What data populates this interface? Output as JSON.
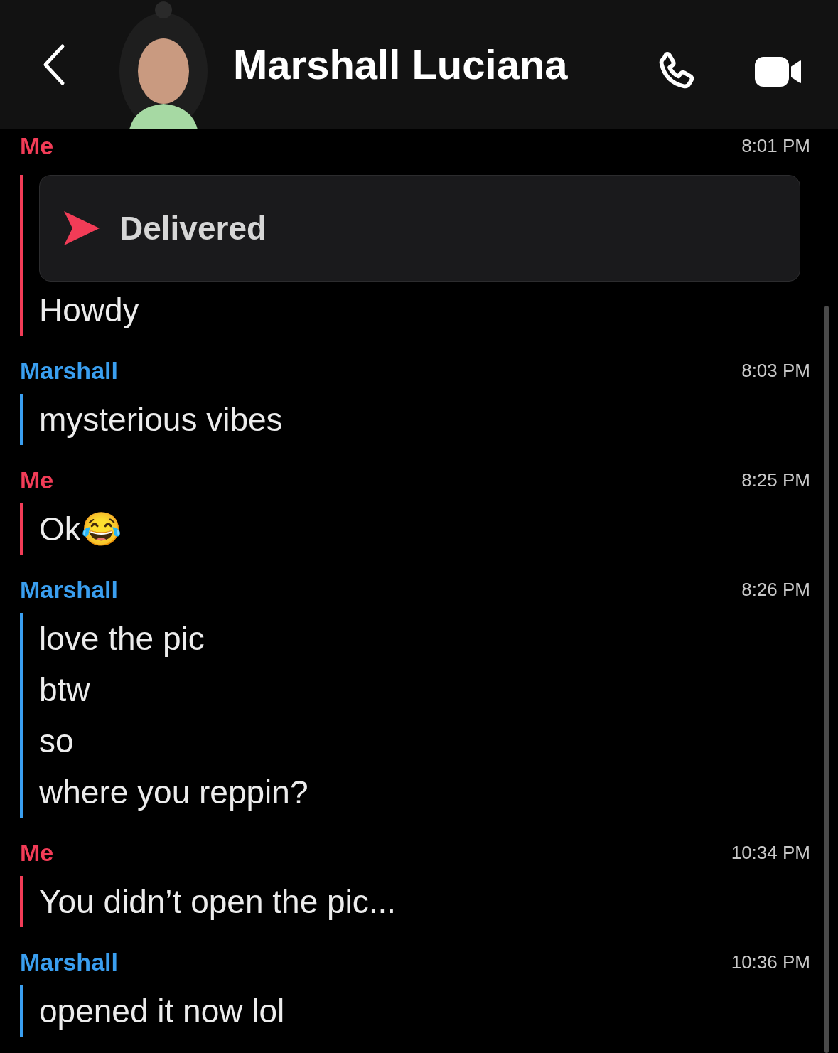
{
  "header": {
    "title": "Marshall Luciana"
  },
  "messages": [
    {
      "sender": "Me",
      "color": "#f23c57",
      "time": "8:01 PM",
      "items": [
        {
          "kind": "status",
          "text": "Delivered"
        },
        {
          "kind": "text",
          "text": "Howdy"
        }
      ]
    },
    {
      "sender": "Marshall",
      "color": "#3a9ff0",
      "time": "8:03 PM",
      "items": [
        {
          "kind": "text",
          "text": "mysterious vibes"
        }
      ]
    },
    {
      "sender": "Me",
      "color": "#f23c57",
      "time": "8:25 PM",
      "items": [
        {
          "kind": "text",
          "text": "Ok😂"
        }
      ]
    },
    {
      "sender": "Marshall",
      "color": "#3a9ff0",
      "time": "8:26 PM",
      "items": [
        {
          "kind": "text",
          "text": "love the pic"
        },
        {
          "kind": "text",
          "text": "btw"
        },
        {
          "kind": "text",
          "text": "so"
        },
        {
          "kind": "text",
          "text": "where you reppin?"
        }
      ]
    },
    {
      "sender": "Me",
      "color": "#f23c57",
      "time": "10:34 PM",
      "items": [
        {
          "kind": "text",
          "text": "You didn’t open the pic..."
        }
      ]
    },
    {
      "sender": "Marshall",
      "color": "#3a9ff0",
      "time": "10:36 PM",
      "items": [
        {
          "kind": "text",
          "text": "opened it now lol"
        }
      ]
    }
  ]
}
